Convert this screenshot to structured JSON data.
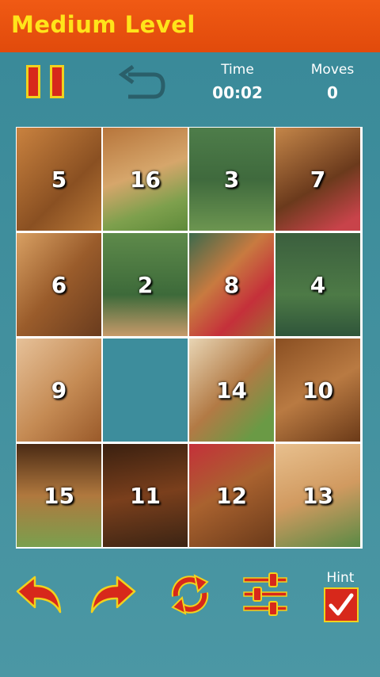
{
  "header": {
    "title": "Medium Level"
  },
  "stats": {
    "time_label": "Time",
    "time_value": "00:02",
    "moves_label": "Moves",
    "moves_value": "0"
  },
  "board": {
    "tiles": [
      "5",
      "16",
      "3",
      "7",
      "6",
      "2",
      "8",
      "4",
      "9",
      "",
      "14",
      "10",
      "15",
      "11",
      "12",
      "13"
    ]
  },
  "toolbar": {
    "hint_label": "Hint",
    "hint_checked": true
  },
  "colors": {
    "accent_orange": "#e94f0f",
    "title_yellow": "#ffe41a",
    "icon_red": "#d7281b",
    "background_teal": "#3d8d9c"
  }
}
